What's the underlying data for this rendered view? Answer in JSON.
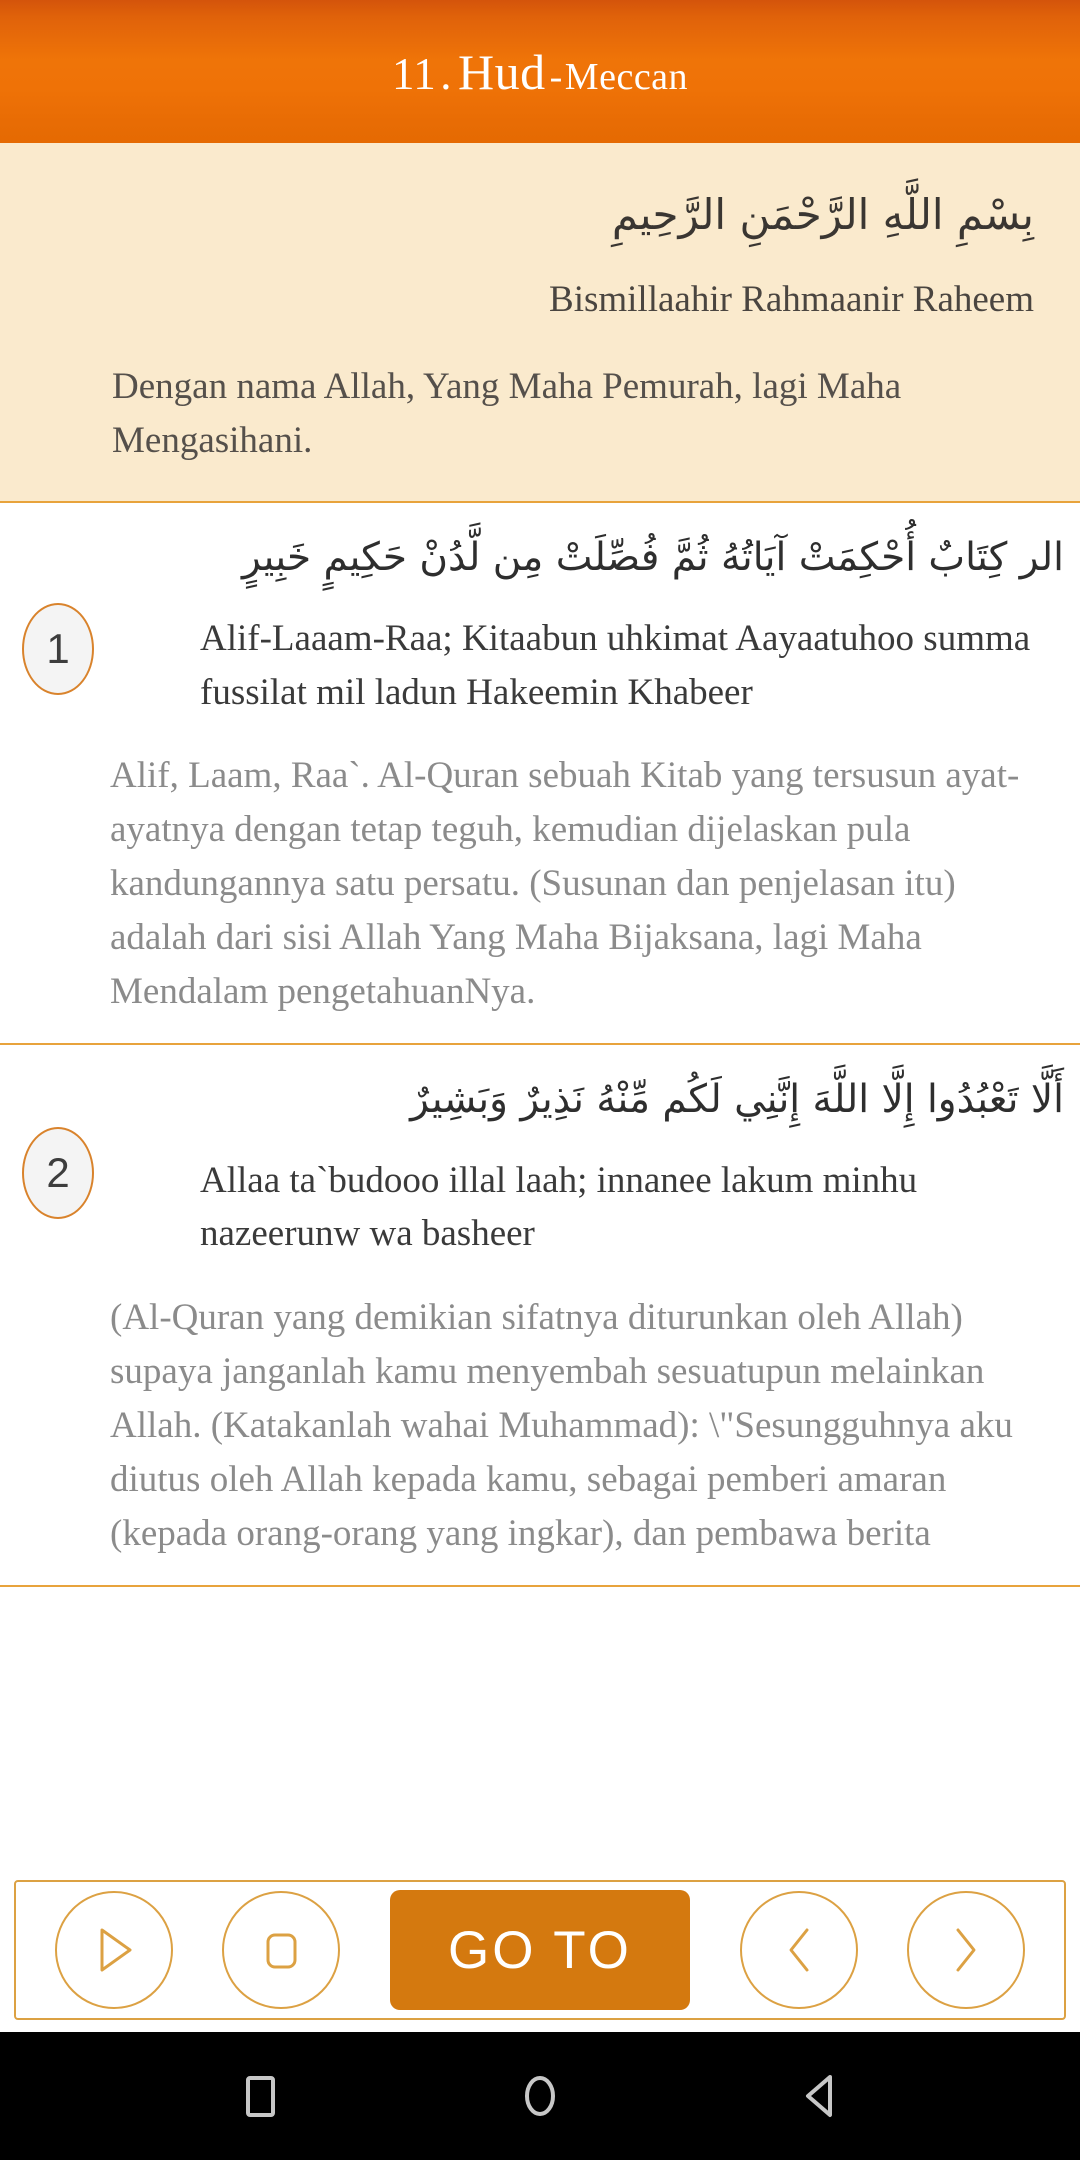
{
  "header": {
    "surah_number": "11",
    "separator_dot": ".",
    "surah_name": "Hud",
    "dash": "-",
    "revelation_type": "Meccan"
  },
  "bismillah": {
    "arabic": "بِسْمِ اللَّهِ الرَّحْمَنِ الرَّحِيمِ",
    "transliteration": "Bismillaahir Rahmaanir Raheem",
    "translation": "Dengan nama Allah, Yang Maha Pemurah, lagi Maha Mengasihani."
  },
  "verses": [
    {
      "number": "1",
      "arabic": "الر كِتَابٌ أُحْكِمَتْ آيَاتُهُ ثُمَّ فُصِّلَتْ مِن لَّدُنْ حَكِيمٍ خَبِيرٍ",
      "transliteration": "Alif-Laaam-Raa; Kitaabun uhkimat Aayaatuhoo summa fussilat mil ladun Hakeemin Khabeer",
      "translation": "Alif, Laam, Raa`. Al-Quran sebuah Kitab yang tersusun ayat-ayatnya dengan tetap teguh, kemudian dijelaskan pula kandungannya satu persatu. (Susunan dan penjelasan itu) adalah dari sisi Allah Yang Maha Bijaksana, lagi Maha Mendalam pengetahuanNya."
    },
    {
      "number": "2",
      "arabic": "أَلَّا تَعْبُدُوا إِلَّا اللَّهَ إِنَّنِي لَكُم مِّنْهُ نَذِيرٌ وَبَشِيرٌ",
      "transliteration": "Allaa ta`budooo illal laah; innanee lakum minhu nazeerunw wa basheer",
      "translation": "(Al-Quran yang demikian sifatnya diturunkan oleh Allah) supaya janganlah kamu menyembah sesuatupun melainkan Allah. (Katakanlah wahai Muhammad): \\\"Sesungguhnya aku diutus oleh Allah kepada kamu, sebagai pemberi amaran (kepada orang-orang yang ingkar), dan pembawa berita"
    }
  ],
  "toolbar": {
    "play_icon": "play-icon",
    "stop_icon": "stop-icon",
    "goto_label": "GO TO",
    "prev_icon": "chevron-left-icon",
    "next_icon": "chevron-right-icon"
  },
  "navbar": {
    "recents_icon": "square-recents-icon",
    "home_icon": "circle-home-icon",
    "back_icon": "triangle-back-icon"
  },
  "colors": {
    "header_accent": "#ee7008",
    "bismillah_bg": "#faeacd",
    "divider": "#e8a33c",
    "goto_button": "#d4790f",
    "badge_border": "#d9832c",
    "translation_text": "#8b8b8b"
  }
}
